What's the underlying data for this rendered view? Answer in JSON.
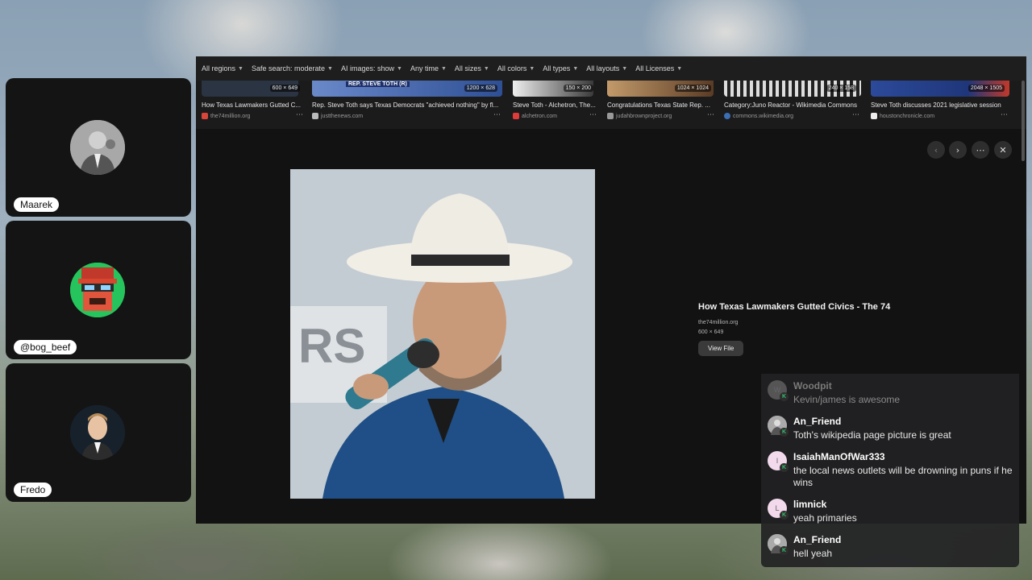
{
  "participants": [
    {
      "name": "Maarek",
      "icon": "portrait-photo-icon"
    },
    {
      "name": "@bog_beef",
      "icon": "pixel-art-face-icon"
    },
    {
      "name": "Fredo",
      "icon": "portrait-photo-icon"
    }
  ],
  "filters": [
    "All regions",
    "Safe search: moderate",
    "AI images: show",
    "Any time",
    "All sizes",
    "All colors",
    "All types",
    "All layouts",
    "All Licenses"
  ],
  "thumbnails": [
    {
      "dims": "600 × 649",
      "caption": "How Texas Lawmakers Gutted C...",
      "source": "the74million.org"
    },
    {
      "dims": "1200 × 628",
      "caption": "Rep. Steve Toth says Texas Democrats \"achieved nothing\" by fl...",
      "source": "justthenews.com",
      "banner": "REP. STEVE TOTH (R)"
    },
    {
      "dims": "150 × 200",
      "caption": "Steve Toth - Alchetron, The...",
      "source": "alchetron.com"
    },
    {
      "dims": "1024 × 1024",
      "caption": "Congratulations Texas State Rep. ...",
      "source": "judahbrownproject.org"
    },
    {
      "dims": "240 × 158",
      "caption": "Category:Juno Reactor - Wikimedia Commons",
      "source": "commons.wikimedia.org"
    },
    {
      "dims": "2048 × 1505",
      "caption": "Steve Toth discusses 2021 legislative session",
      "source": "houstonchronicle.com"
    }
  ],
  "detail": {
    "title": "How Texas Lawmakers Gutted Civics - The 74",
    "domain": "the74million.org",
    "size": "600 × 649",
    "view_button": "View File"
  },
  "chat": [
    {
      "user": "Woodpit",
      "text": "Kevin/james is awesome",
      "initial": "W",
      "faded": true
    },
    {
      "user": "An_Friend",
      "text": "Toth's wikipedia page picture is great",
      "initial": ""
    },
    {
      "user": "IsaiahManOfWar333",
      "text": "the local news outlets will be drowning in puns if he wins",
      "initial": "I"
    },
    {
      "user": "limnick",
      "text": "yeah primaries",
      "initial": "L"
    },
    {
      "user": "An_Friend",
      "text": "hell yeah",
      "initial": ""
    }
  ],
  "colors": {
    "accent_green": "#35c06a",
    "panel_dark": "#141414"
  }
}
